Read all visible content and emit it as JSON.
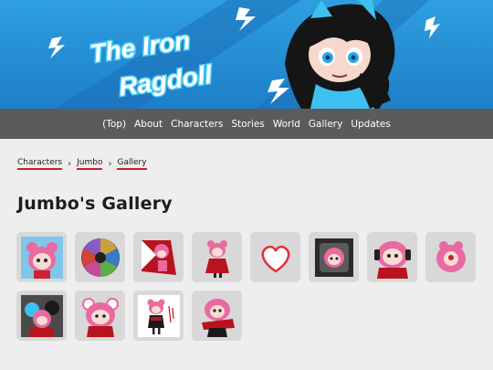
{
  "banner": {
    "title_line1": "The Iron",
    "title_line2": "Ragdoll"
  },
  "nav": [
    {
      "label": "(Top)"
    },
    {
      "label": "About"
    },
    {
      "label": "Characters"
    },
    {
      "label": "Stories"
    },
    {
      "label": "World"
    },
    {
      "label": "Gallery"
    },
    {
      "label": "Updates"
    }
  ],
  "breadcrumb": [
    {
      "label": "Characters"
    },
    {
      "label": "Jumbo"
    },
    {
      "label": "Gallery"
    }
  ],
  "page_title": "Jumbo's Gallery",
  "gallery": [
    {
      "icon": "jumbo-portrait-blue-bg-thumbnail"
    },
    {
      "icon": "color-wheel-thumbnail"
    },
    {
      "icon": "jumbo-red-diamond-thumbnail"
    },
    {
      "icon": "jumbo-standing-thumbnail"
    },
    {
      "icon": "heart-thumbnail"
    },
    {
      "icon": "jumbo-dark-frame-thumbnail"
    },
    {
      "icon": "jumbo-dark-headphones-thumbnail"
    },
    {
      "icon": "pink-blob-thumbnail"
    },
    {
      "icon": "group-characters-thumbnail"
    },
    {
      "icon": "jumbo-bear-ears-thumbnail"
    },
    {
      "icon": "jumbo-sketch-signed-thumbnail"
    },
    {
      "icon": "jumbo-red-outfit-thumbnail"
    }
  ],
  "colors": {
    "banner_blue": "#2e9fe0",
    "nav_bg": "#5b5b5b",
    "accent_red": "#cc1f2d",
    "page_bg": "#eeeeee",
    "thumb_bg": "#d8d8d8"
  }
}
